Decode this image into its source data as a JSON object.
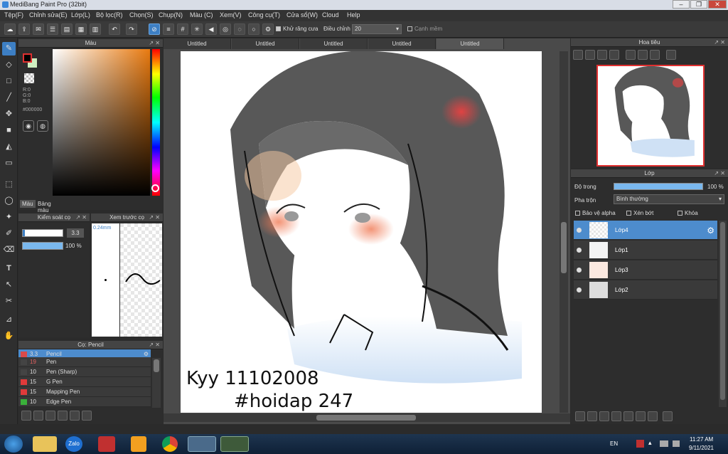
{
  "window": {
    "title": "MediBang Paint Pro (32bit)"
  },
  "menu": [
    "Tệp(F)",
    "Chỉnh sửa(E)",
    "Lớp(L)",
    "Bộ lọc(R)",
    "Chọn(S)",
    "Chụp(N)",
    "Màu (C)",
    "Xem(V)",
    "Công cụ(T)",
    "Cửa sổ(W)",
    "Cloud",
    "Help"
  ],
  "toolbar": {
    "antialias_label": "Khử răng cưa",
    "adjust_label": "Điều chỉnh",
    "adjust_value": "20",
    "soften_label": "Cạnh mềm"
  },
  "color_panel": {
    "title": "Màu",
    "r": "R:0",
    "g": "G:0",
    "b": "B:0",
    "hex": "#000000",
    "tabs": [
      "Màu",
      "Bảng màu"
    ],
    "fg": "#000000",
    "bg": "#cfeec0"
  },
  "brush_control": {
    "title": "Kiểm soát cọ",
    "size": "3.3",
    "opacity": "100 %"
  },
  "brush_preview": {
    "title": "Xem trước cọ",
    "size_label": "0.24mm"
  },
  "brush_list": {
    "title": "Cọ: Pencil",
    "items": [
      {
        "size": "3.3",
        "name": "Pencil",
        "color": "#d94a4a"
      },
      {
        "size": "19",
        "name": "Pen",
        "color": "#444444"
      },
      {
        "size": "10",
        "name": "Pen (Sharp)",
        "color": "#444444"
      },
      {
        "size": "15",
        "name": "G Pen",
        "color": "#e03a3a"
      },
      {
        "size": "15",
        "name": "Mapping Pen",
        "color": "#e03a3a"
      },
      {
        "size": "10",
        "name": "Edge Pen",
        "color": "#3ab03a"
      }
    ]
  },
  "tabs": [
    "Untitled",
    "Untitled",
    "Untitled",
    "Untitled",
    "Untitled"
  ],
  "canvas": {
    "signature_line1": "Kyy 11102008",
    "signature_line2": "#hoidap 247"
  },
  "navigator": {
    "title": "Hoa tiêu"
  },
  "layers": {
    "title": "Lớp",
    "opacity_label": "Độ trong",
    "opacity_value": "100 %",
    "blend_label": "Pha trộn",
    "blend_value": "Bình thường",
    "protect_alpha": "Bảo vệ alpha",
    "clipping": "Xén bớt",
    "lock": "Khóa",
    "items": [
      {
        "name": "Lớp4"
      },
      {
        "name": "Lớp1"
      },
      {
        "name": "Lớp3"
      },
      {
        "name": "Lớp2"
      }
    ]
  },
  "taskbar": {
    "lang": "EN",
    "time": "11:27 AM",
    "date": "9/11/2021",
    "zalo": "Zalo"
  }
}
